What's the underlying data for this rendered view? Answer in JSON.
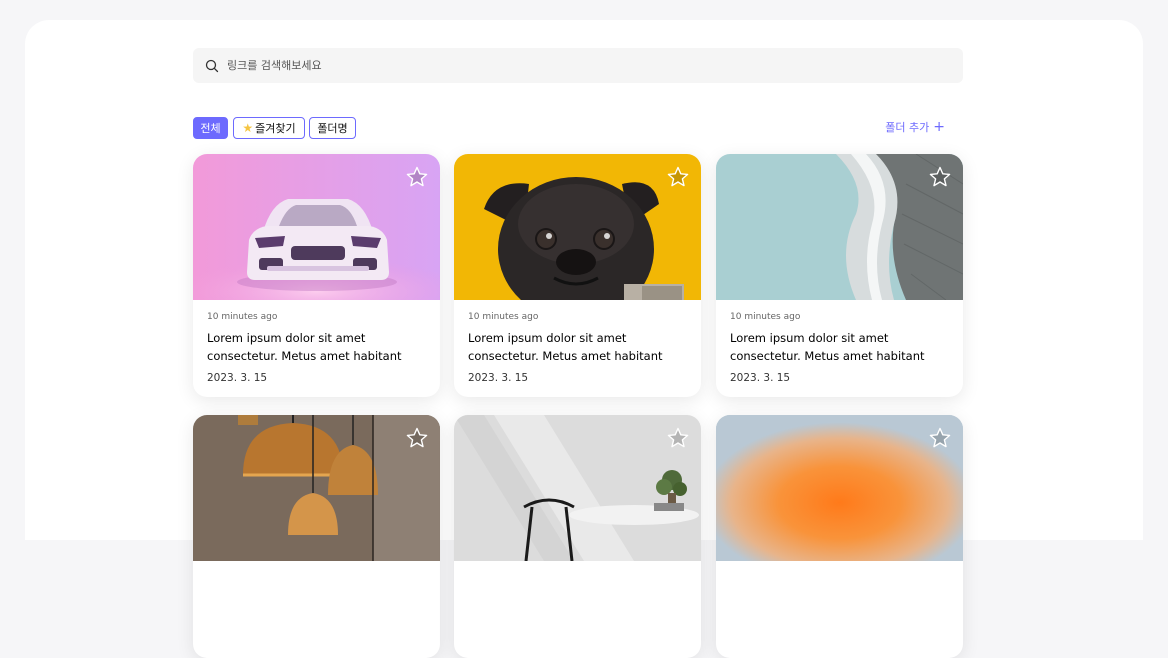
{
  "search": {
    "placeholder": "링크를 검색해보세요"
  },
  "filters": {
    "items": [
      {
        "label": "전체",
        "active": true
      },
      {
        "label": "즐겨찾기",
        "icon": "star-emoji-icon",
        "active": false
      },
      {
        "label": "폴더명",
        "active": false
      }
    ],
    "add_folder_label": "폴더 추가",
    "add_folder_icon": "plus-icon"
  },
  "cards": [
    {
      "image": "pink-sports-car-photo",
      "time": "10 minutes ago",
      "description": "Lorem ipsum dolor sit amet consectetur. Metus amet habitant nunc consequat....",
      "date": "2023. 3. 15"
    },
    {
      "image": "pug-dog-photo",
      "time": "10 minutes ago",
      "description": "Lorem ipsum dolor sit amet consectetur. Metus amet habitant nunc consequat....",
      "date": "2023. 3. 15"
    },
    {
      "image": "curved-architecture-photo",
      "time": "10 minutes ago",
      "description": "Lorem ipsum dolor sit amet consectetur. Metus amet habitant nunc consequat....",
      "date": "2023. 3. 15"
    },
    {
      "image": "pendant-lamps-photo",
      "time": "",
      "description": "",
      "date": ""
    },
    {
      "image": "dining-chair-plant-photo",
      "time": "",
      "description": "",
      "date": ""
    },
    {
      "image": "orange-gradient-blur-photo",
      "time": "",
      "description": "",
      "date": ""
    }
  ],
  "colors": {
    "accent": "#6d6afe",
    "background": "#f6f6f8",
    "search_bg": "#f5f5f5"
  }
}
